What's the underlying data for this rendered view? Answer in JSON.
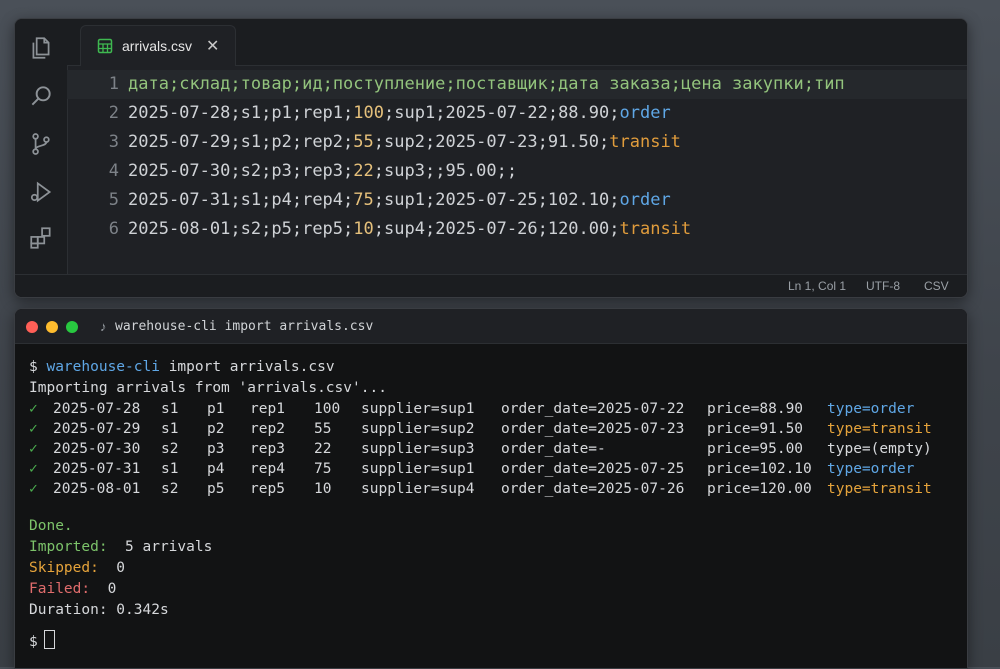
{
  "editor": {
    "tab": {
      "filename": "arrivals.csv",
      "close": "✕"
    },
    "activity_icons": [
      "files-icon",
      "search-icon",
      "source-control-icon",
      "run-debug-icon",
      "extensions-icon"
    ],
    "lines": [
      {
        "num": "1",
        "type": "header",
        "fields": [
          "дата",
          "склад",
          "товар",
          "ид",
          "поступление",
          "поставщик",
          "дата заказа",
          "цена закупки",
          "тип"
        ]
      },
      {
        "num": "2",
        "fields": [
          "2025-07-28",
          "s1",
          "p1",
          "rep1",
          "100",
          "sup1",
          "2025-07-22",
          "88.90",
          "order"
        ]
      },
      {
        "num": "3",
        "fields": [
          "2025-07-29",
          "s1",
          "p2",
          "rep2",
          "55",
          "sup2",
          "2025-07-23",
          "91.50",
          "transit"
        ]
      },
      {
        "num": "4",
        "fields": [
          "2025-07-30",
          "s2",
          "p3",
          "rep3",
          "22",
          "sup3",
          "",
          "95.00",
          ""
        ]
      },
      {
        "num": "5",
        "fields": [
          "2025-07-31",
          "s1",
          "p4",
          "rep4",
          "75",
          "sup1",
          "2025-07-25",
          "102.10",
          "order"
        ]
      },
      {
        "num": "6",
        "fields": [
          "2025-08-01",
          "s2",
          "p5",
          "rep5",
          "10",
          "sup4",
          "2025-07-26",
          "120.00",
          "transit"
        ]
      }
    ],
    "status": {
      "position": "Ln 1, Col 1",
      "encoding": "UTF-8",
      "language": "CSV"
    }
  },
  "terminal": {
    "title": "warehouse-cli import arrivals.csv",
    "prompt": "$",
    "command_name": "warehouse-cli",
    "command_args": "import arrivals.csv",
    "importing_msg": "Importing arrivals from 'arrivals.csv'...",
    "rows": [
      {
        "date": "2025-07-28",
        "store": "s1",
        "product": "p1",
        "id": "rep1",
        "qty": "100",
        "supplier": "supplier=sup1",
        "order_date": "order_date=2025-07-22",
        "price": "price=88.90",
        "type": "type=order",
        "type_color": "blue"
      },
      {
        "date": "2025-07-29",
        "store": "s1",
        "product": "p2",
        "id": "rep2",
        "qty": "55",
        "supplier": "supplier=sup2",
        "order_date": "order_date=2025-07-23",
        "price": "price=91.50",
        "type": "type=transit",
        "type_color": "orange"
      },
      {
        "date": "2025-07-30",
        "store": "s2",
        "product": "p3",
        "id": "rep3",
        "qty": "22",
        "supplier": "supplier=sup3",
        "order_date": "order_date=-",
        "price": "price=95.00",
        "type": "type=(empty)",
        "type_color": "plain"
      },
      {
        "date": "2025-07-31",
        "store": "s1",
        "product": "p4",
        "id": "rep4",
        "qty": "75",
        "supplier": "supplier=sup1",
        "order_date": "order_date=2025-07-25",
        "price": "price=102.10",
        "type": "type=order",
        "type_color": "blue"
      },
      {
        "date": "2025-08-01",
        "store": "s2",
        "product": "p5",
        "id": "rep5",
        "qty": "10",
        "supplier": "supplier=sup4",
        "order_date": "order_date=2025-07-26",
        "price": "price=120.00",
        "type": "type=transit",
        "type_color": "orange"
      }
    ],
    "done": "Done.",
    "summary": [
      {
        "label": "Imported:",
        "value": "5 arrivals",
        "color": "green"
      },
      {
        "label": "Skipped:",
        "value": "0",
        "color": "orange"
      },
      {
        "label": "Failed:",
        "value": "0",
        "color": "red"
      },
      {
        "label": "Duration:",
        "value": "0.342s",
        "color": "plain"
      }
    ],
    "colors": {
      "red": "#ff5f57",
      "yellow": "#febc2e",
      "green": "#28c840"
    }
  }
}
